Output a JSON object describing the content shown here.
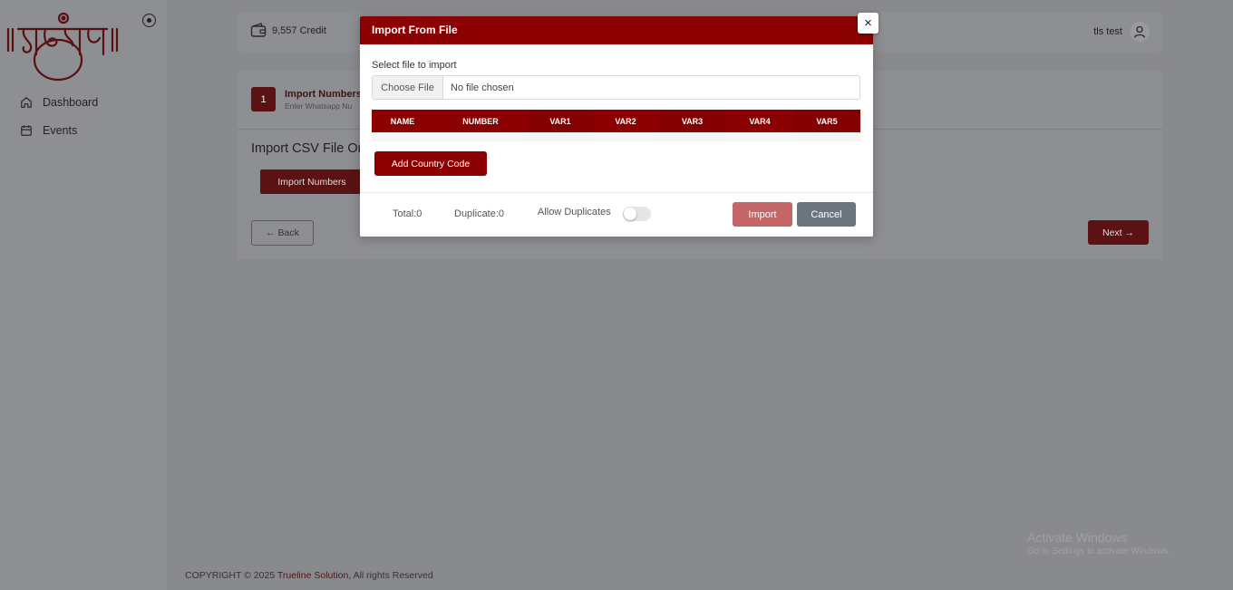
{
  "sidebar": {
    "logo_text": "आमंत्रणम",
    "items": [
      {
        "label": "Dashboard",
        "icon": "home-icon"
      },
      {
        "label": "Events",
        "icon": "calendar-icon"
      }
    ]
  },
  "header": {
    "credit": "9,557 Credit",
    "user_name": "tls test"
  },
  "step": {
    "number": "1",
    "title": "Import Numbers",
    "subtitle": "Enter Whatsapp Nu"
  },
  "section": {
    "heading": "Import CSV File Or",
    "import_button": "Import Numbers",
    "back": "← Back",
    "next": "Next →"
  },
  "footer": {
    "prefix": "COPYRIGHT © 2025 ",
    "brand": "Trueline Solution",
    "suffix": ", All rights Reserved"
  },
  "watermark": {
    "line1": "Activate Windows",
    "line2": "Go to Settings to activate Windows."
  },
  "modal": {
    "title": "Import From File",
    "close": "×",
    "file_label": "Select file to import",
    "choose_file": "Choose File",
    "file_status": "No file chosen",
    "columns": [
      "NAME",
      "NUMBER",
      "VAR1",
      "VAR2",
      "VAR3",
      "VAR4",
      "VAR5"
    ],
    "add_country_code": "Add Country Code",
    "total": "Total:0",
    "duplicate": "Duplicate:0",
    "allow_duplicates": "Allow Duplicates",
    "allow_duplicates_on": false,
    "import": "Import",
    "cancel": "Cancel"
  },
  "colors": {
    "brand": "#8b0000",
    "import_disabled": "#c46668",
    "cancel": "#6c757d"
  }
}
